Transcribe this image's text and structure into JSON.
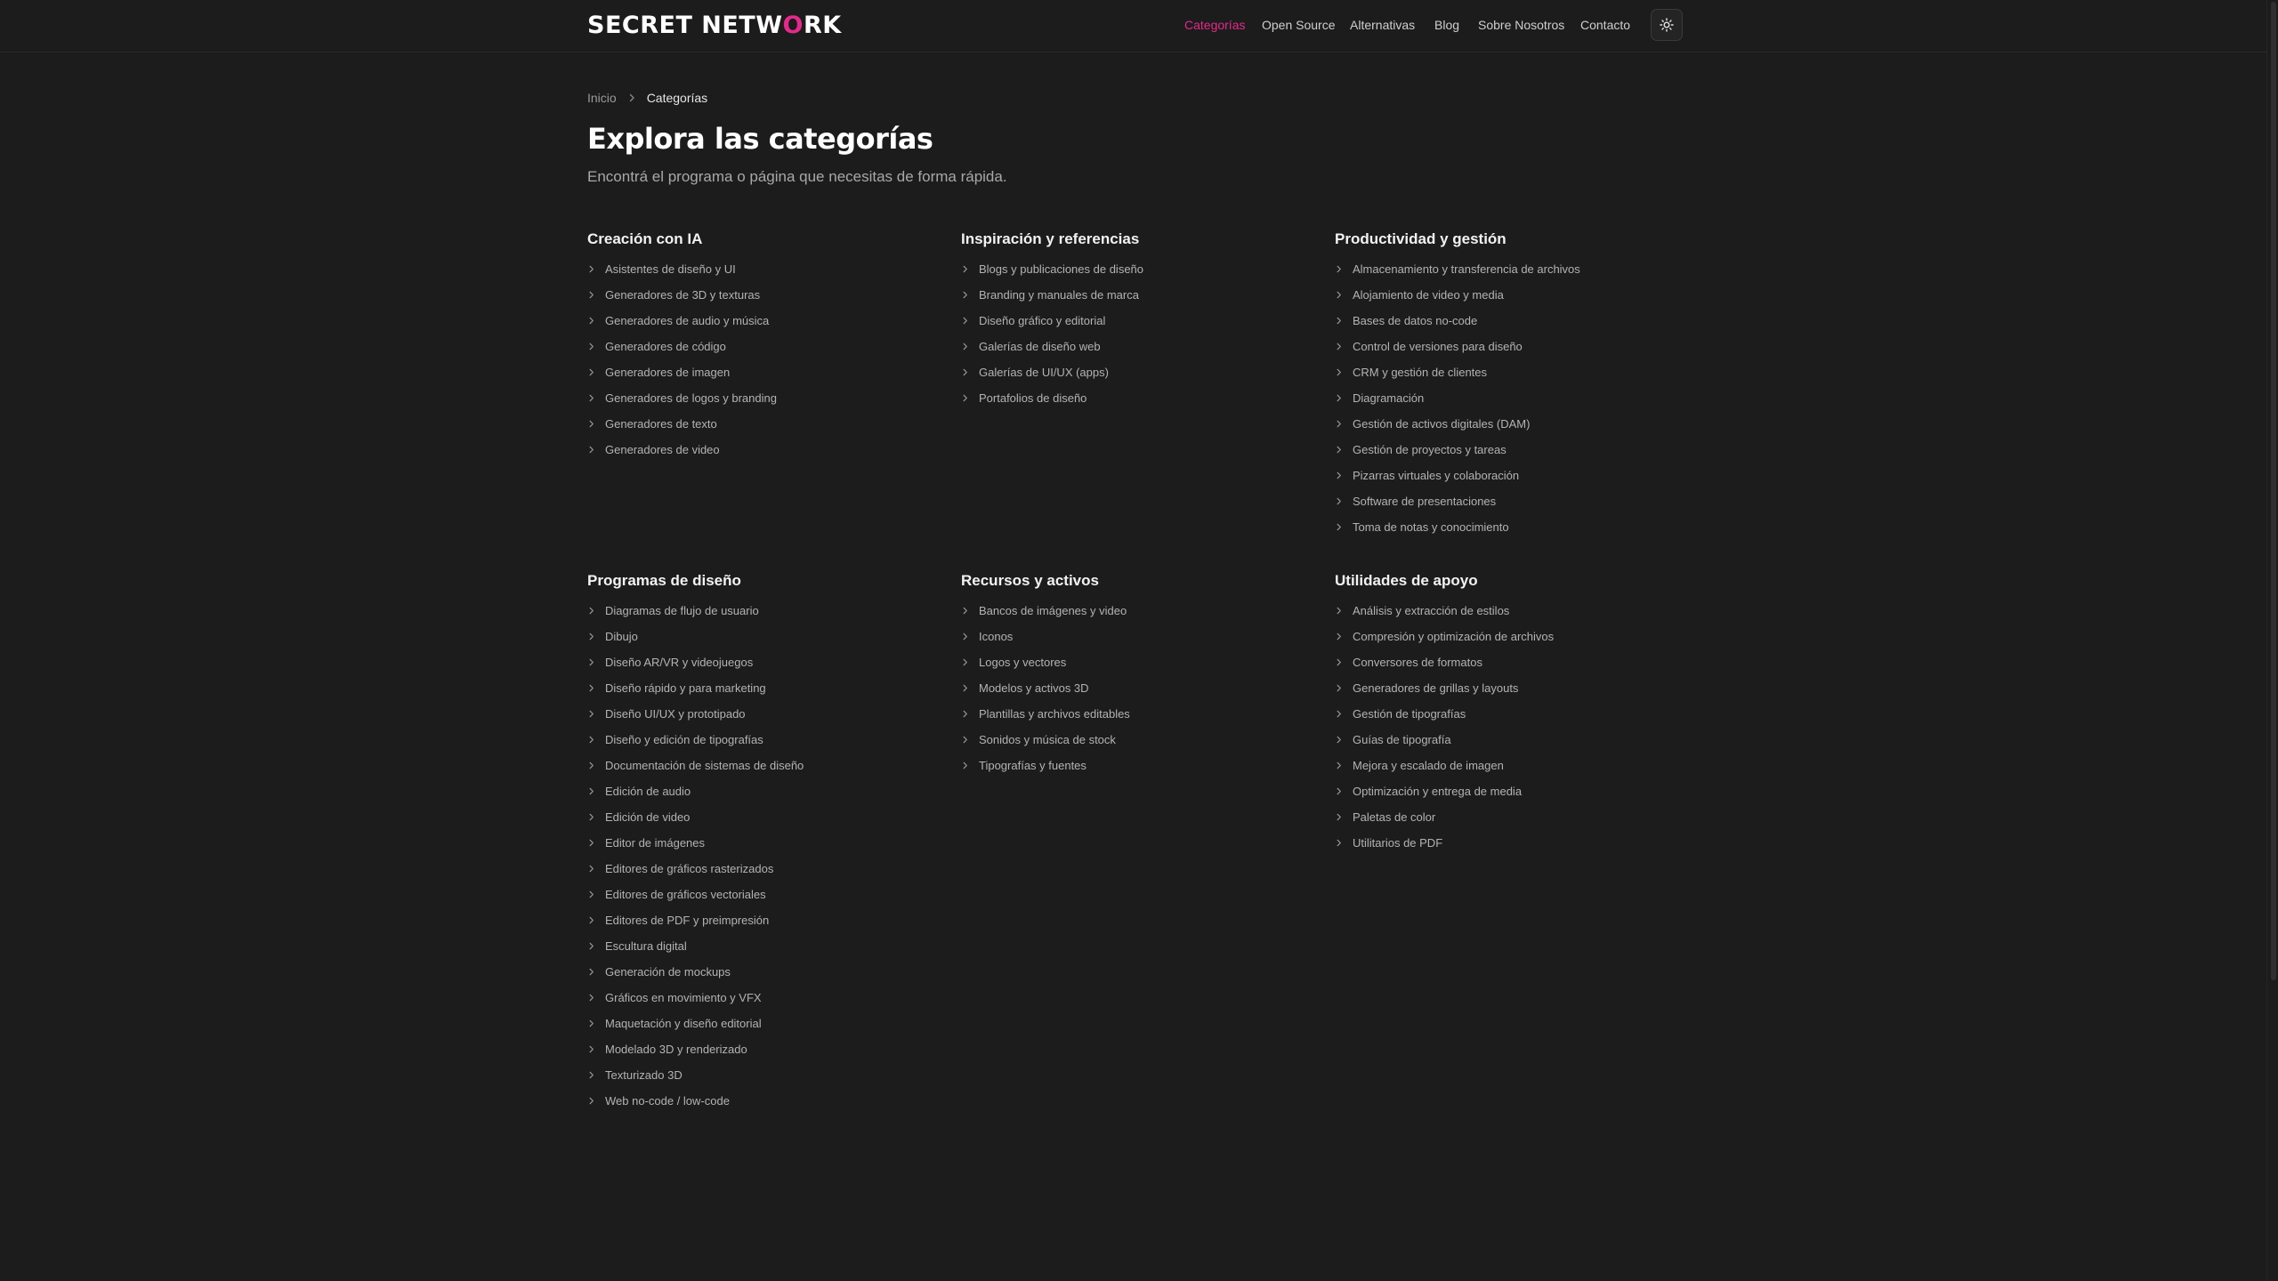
{
  "header": {
    "logo_prefix": "SECRET NETW",
    "logo_accent": "O",
    "logo_suffix": "RK",
    "nav": [
      "Categorías",
      "Open Source",
      "Alternativas",
      "Blog",
      "Sobre Nosotros",
      "Contacto"
    ],
    "active_nav": "Categorías",
    "theme_icon": "sun-icon"
  },
  "breadcrumb": {
    "home": "Inicio",
    "current": "Categorías"
  },
  "page": {
    "title": "Explora las categorías",
    "subtitle": "Encontrá el programa o página que necesitas de forma rápida."
  },
  "colors": {
    "background": "#1c1c1c",
    "accent": "#e5288b",
    "text": "#d0d0d0"
  },
  "categories": [
    {
      "title": "Creación con IA",
      "items": [
        "Asistentes de diseño y UI",
        "Generadores de 3D y texturas",
        "Generadores de audio y música",
        "Generadores de código",
        "Generadores de imagen",
        "Generadores de logos y branding",
        "Generadores de texto",
        "Generadores de video"
      ]
    },
    {
      "title": "Inspiración y referencias",
      "items": [
        "Blogs y publicaciones de diseño",
        "Branding y manuales de marca",
        "Diseño gráfico y editorial",
        "Galerías de diseño web",
        "Galerías de UI/UX (apps)",
        "Portafolios de diseño"
      ]
    },
    {
      "title": "Productividad y gestión",
      "items": [
        "Almacenamiento y transferencia de archivos",
        "Alojamiento de video y media",
        "Bases de datos no-code",
        "Control de versiones para diseño",
        "CRM y gestión de clientes",
        "Diagramación",
        "Gestión de activos digitales (DAM)",
        "Gestión de proyectos y tareas",
        "Pizarras virtuales y colaboración",
        "Software de presentaciones",
        "Toma de notas y conocimiento"
      ]
    },
    {
      "title": "Programas de diseño",
      "items": [
        "Diagramas de flujo de usuario",
        "Dibujo",
        "Diseño AR/VR y videojuegos",
        "Diseño rápido y para marketing",
        "Diseño UI/UX y prototipado",
        "Diseño y edición de tipografías",
        "Documentación de sistemas de diseño",
        "Edición de audio",
        "Edición de video",
        "Editor de imágenes",
        "Editores de gráficos rasterizados",
        "Editores de gráficos vectoriales",
        "Editores de PDF y preimpresión",
        "Escultura digital",
        "Generación de mockups",
        "Gráficos en movimiento y VFX",
        "Maquetación y diseño editorial",
        "Modelado 3D y renderizado",
        "Texturizado 3D",
        "Web no-code / low-code"
      ]
    },
    {
      "title": "Recursos y activos",
      "items": [
        "Bancos de imágenes y video",
        "Iconos",
        "Logos y vectores",
        "Modelos y activos 3D",
        "Plantillas y archivos editables",
        "Sonidos y música de stock",
        "Tipografías y fuentes"
      ]
    },
    {
      "title": "Utilidades de apoyo",
      "items": [
        "Análisis y extracción de estilos",
        "Compresión y optimización de archivos",
        "Conversores de formatos",
        "Generadores de grillas y layouts",
        "Gestión de tipografías",
        "Guías de tipografía",
        "Mejora y escalado de imagen",
        "Optimización y entrega de media",
        "Paletas de color",
        "Utilitarios de PDF"
      ]
    }
  ]
}
